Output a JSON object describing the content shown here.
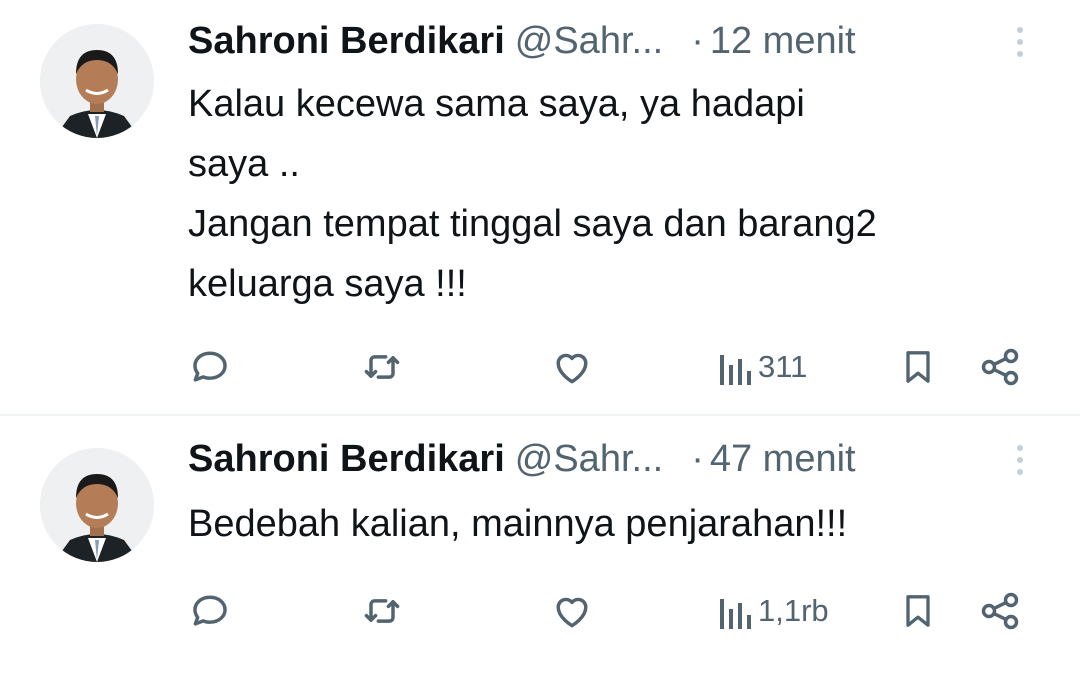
{
  "tweets": [
    {
      "author_name": "Sahroni Berdikari",
      "handle": "@Sahr...",
      "separator": "·",
      "time": "12 menit",
      "text_lines": [
        "Kalau kecewa sama saya, ya hadapi",
        "saya ..",
        "Jangan tempat tinggal saya dan barang2",
        "keluarga saya !!!"
      ],
      "views": "311"
    },
    {
      "author_name": "Sahroni Berdikari",
      "handle": "@Sahr...",
      "separator": "·",
      "time": "47 menit",
      "text_lines": [
        "Bedebah kalian, mainnya penjarahan!!!"
      ],
      "views": "1,1rb"
    }
  ],
  "icons": {
    "reply": "reply-icon",
    "retweet": "retweet-icon",
    "like": "like-icon",
    "views": "views-icon",
    "bookmark": "bookmark-icon",
    "share": "share-icon",
    "more": "more-icon"
  },
  "colors": {
    "text": "#0f1419",
    "secondary": "#536471",
    "divider": "#eff3f4"
  }
}
